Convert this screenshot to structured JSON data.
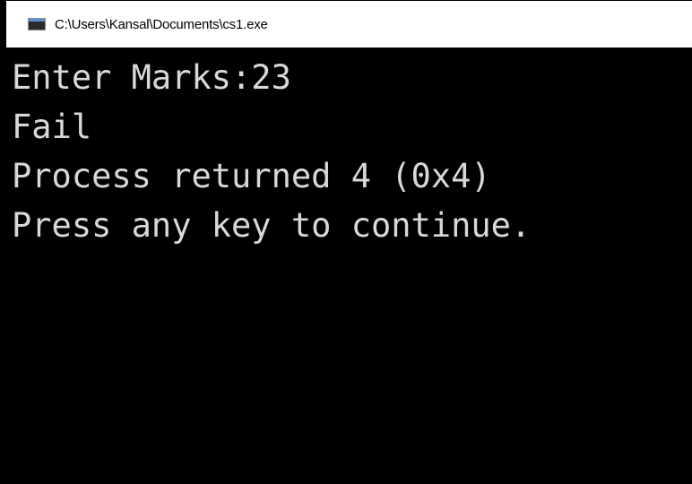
{
  "window": {
    "title": "C:\\Users\\Kansal\\Documents\\cs1.exe",
    "icon": "console-app-icon"
  },
  "console": {
    "lines": [
      "Enter Marks:23",
      "Fail",
      "Process returned 4 (0x4)",
      "Press any key to continue."
    ],
    "colors": {
      "background": "#000000",
      "text": "#d8d8d8"
    }
  }
}
